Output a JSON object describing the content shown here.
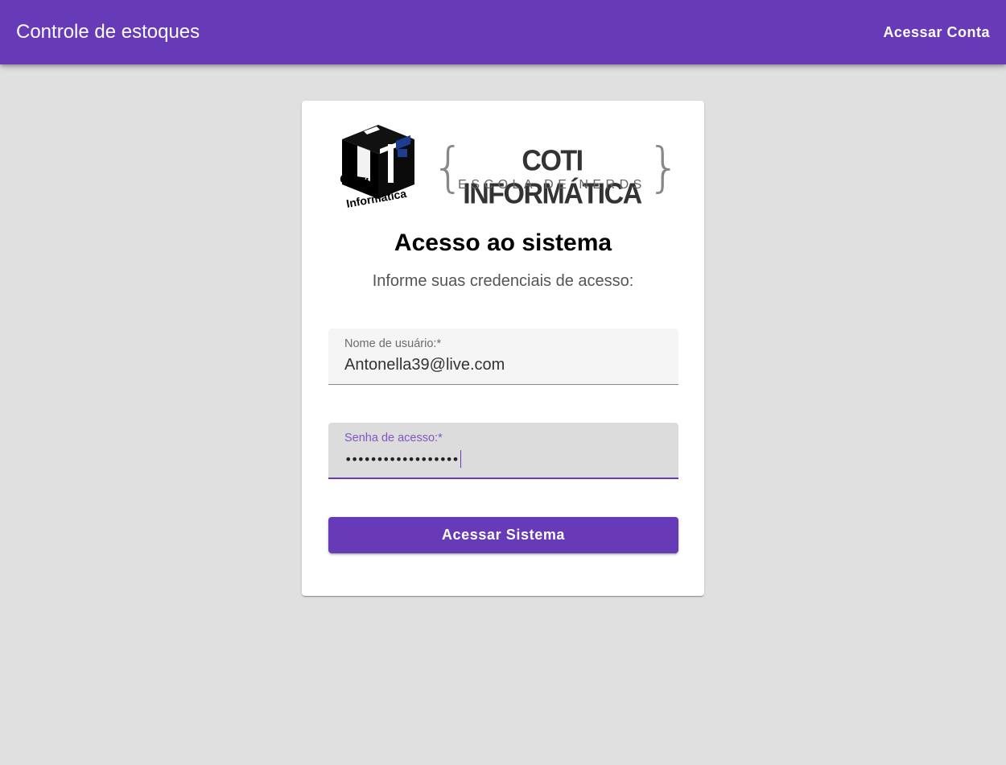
{
  "colors": {
    "primary": "#673ab7",
    "background": "#e0e0e0",
    "card": "#ffffff",
    "focused_label": "#7e57c2"
  },
  "toolbar": {
    "title": "Controle de estoques",
    "account_link": "Acessar Conta"
  },
  "logo": {
    "icon": "coti-cube-logo",
    "cube_text_line1": "COTI",
    "cube_text_line2": "Informática",
    "brand_name": "COTI INFORMÁTICA",
    "brand_tagline": "ESCOLA DE NERDS",
    "brace_left": "{",
    "brace_right": "}"
  },
  "login": {
    "title": "Acesso ao sistema",
    "subtitle": "Informe suas credenciais de acesso:",
    "username": {
      "label": "Nome de usuário:*",
      "value": "Antonella39@live.com"
    },
    "password": {
      "label": "Senha de acesso:*",
      "masked_value": "••••••••••••••••••",
      "focused": true
    },
    "submit_label": "Acessar Sistema"
  }
}
